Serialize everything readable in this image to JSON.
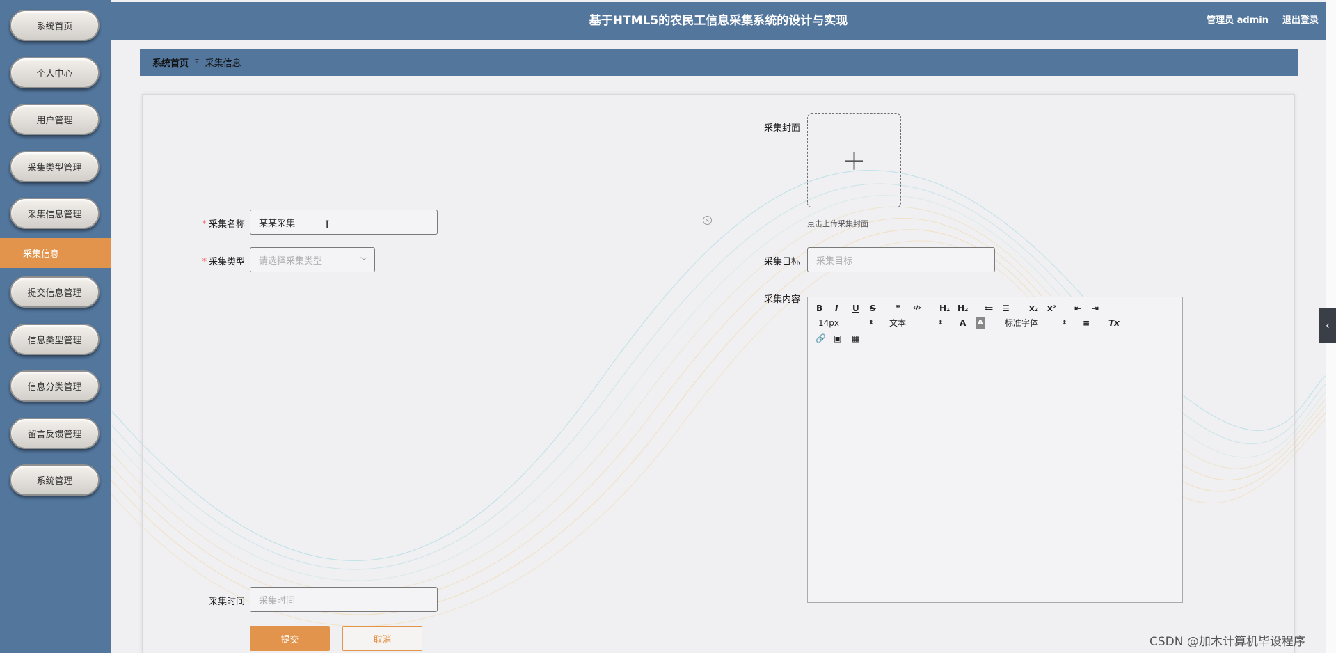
{
  "app": {
    "title": "基于HTML5的农民工信息采集系统的设计与实现",
    "user": "管理员 admin",
    "logout": "退出登录"
  },
  "sidebar": {
    "items": [
      {
        "label": "系统首页"
      },
      {
        "label": "个人中心"
      },
      {
        "label": "用户管理"
      },
      {
        "label": "采集类型管理"
      },
      {
        "label": "采集信息管理"
      },
      {
        "label": "采集信息",
        "active": true
      },
      {
        "label": "提交信息管理"
      },
      {
        "label": "信息类型管理"
      },
      {
        "label": "信息分类管理"
      },
      {
        "label": "留言反馈管理"
      },
      {
        "label": "系统管理"
      }
    ]
  },
  "breadcrumb": {
    "home": "系统首页",
    "separator": "Ξ",
    "current": "采集信息"
  },
  "form": {
    "name": {
      "label": "采集名称",
      "value": "某某采集",
      "required": true
    },
    "type": {
      "label": "采集类型",
      "placeholder": "请选择采集类型",
      "required": true
    },
    "cover": {
      "label": "采集封面",
      "tip": "点击上传采集封面"
    },
    "target": {
      "label": "采集目标",
      "placeholder": "采集目标"
    },
    "content": {
      "label": "采集内容"
    },
    "time": {
      "label": "采集时间",
      "placeholder": "采集时间"
    },
    "submit": "提交",
    "cancel": "取消"
  },
  "editor": {
    "font_size": "14px",
    "paragraph": "文本",
    "font_family": "标准字体",
    "buttons": [
      "B",
      "I",
      "U",
      "S",
      "❞",
      "‹/›",
      "H₁",
      "H₂",
      "≔",
      "☰",
      "x₂",
      "x²",
      "⇤",
      "⇥",
      "A",
      "A",
      "≡",
      "Tx"
    ]
  },
  "watermark": "CSDN @加木计算机毕设程序",
  "colors": {
    "primary": "#53769d",
    "accent": "#e3944c"
  }
}
